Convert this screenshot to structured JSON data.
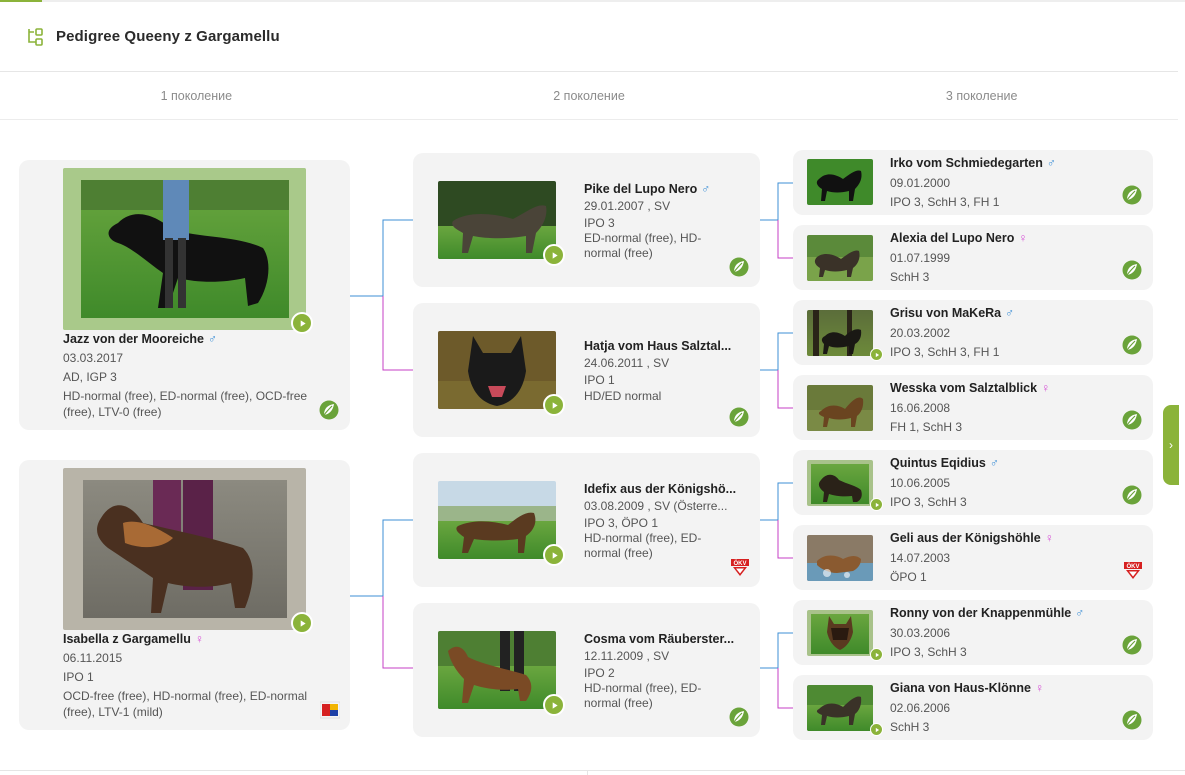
{
  "header": {
    "title": "Pedigree Queeny z Gargamellu",
    "icon": "pedigree-tree-icon"
  },
  "generations": [
    "1 поколение",
    "2 поколение",
    "3 поколение"
  ],
  "colors": {
    "accent": "#8bb33a",
    "male_link": "#3d8fd6",
    "female_link": "#c63fc6"
  },
  "gen1": [
    {
      "name": "Jazz von der Mooreiche",
      "sex": "♂",
      "sexclass": "male",
      "date": "03.03.2017",
      "titles": "AD, IGP 3",
      "health": "HD-normal (free), ED-normal (free), OCD-free (free), LTV-0 (free)",
      "badge": "leaf-icon"
    },
    {
      "name": "Isabella z Gargamellu",
      "sex": "♀",
      "sexclass": "female",
      "date": "06.11.2015",
      "titles": "IPO 1",
      "health": "OCD-free (free), HD-normal (free), ED-normal (free), LTV-1 (mild)",
      "badge": "flag-badge-icon"
    }
  ],
  "gen2": [
    {
      "name": "Pike del Lupo Nero",
      "sex": "♂",
      "sexclass": "male",
      "date": "29.01.2007 , SV",
      "titles": "IPO 3",
      "health": "ED-normal (free), HD-normal (free)",
      "badge": "leaf-icon"
    },
    {
      "name": "Hatja vom Haus Salztal...",
      "sex": "",
      "sexclass": "female",
      "date": "24.06.2011 , SV",
      "titles": "IPO 1",
      "health": "HD/ED normal",
      "badge": "leaf-icon"
    },
    {
      "name": "Idefix aus der Königshö...",
      "sex": "",
      "sexclass": "male",
      "date": "03.08.2009 , SV (Österre...",
      "titles": "IPO 3, ÖPO 1",
      "health": "HD-normal (free), ED-normal (free)",
      "badge": "okv-badge-icon"
    },
    {
      "name": "Cosma vom Räuberster...",
      "sex": "",
      "sexclass": "female",
      "date": "12.11.2009 , SV",
      "titles": "IPO 2",
      "health": "HD-normal (free), ED-normal (free)",
      "badge": "leaf-icon"
    }
  ],
  "gen3": [
    {
      "name": "Irko vom Schmiedegarten",
      "sex": "♂",
      "sexclass": "male",
      "date": "09.01.2000",
      "titles": "IPO 3, SchH 3, FH 1",
      "badge": "leaf-icon"
    },
    {
      "name": "Alexia del Lupo Nero",
      "sex": "♀",
      "sexclass": "female",
      "date": "01.07.1999",
      "titles": "SchH 3",
      "badge": "leaf-icon"
    },
    {
      "name": "Grisu von MaKeRa",
      "sex": "♂",
      "sexclass": "male",
      "date": "20.03.2002",
      "titles": "IPO 3, SchH 3, FH 1",
      "badge": "leaf-icon"
    },
    {
      "name": "Wesska vom Salztalblick",
      "sex": "♀",
      "sexclass": "female",
      "date": "16.06.2008",
      "titles": "FH 1, SchH 3",
      "badge": "leaf-icon"
    },
    {
      "name": "Quintus Eqidius",
      "sex": "♂",
      "sexclass": "male",
      "date": "10.06.2005",
      "titles": "IPO 3, SchH 3",
      "badge": "leaf-icon"
    },
    {
      "name": "Geli aus der Königshöhle",
      "sex": "♀",
      "sexclass": "female",
      "date": "14.07.2003",
      "titles": "ÖPO 1",
      "badge": "okv-badge-icon"
    },
    {
      "name": "Ronny von der Knappenmühle",
      "sex": "♂",
      "sexclass": "male",
      "date": "30.03.2006",
      "titles": "IPO 3, SchH 3",
      "badge": "leaf-icon"
    },
    {
      "name": "Giana von Haus-Klönne",
      "sex": "♀",
      "sexclass": "female",
      "date": "02.06.2006",
      "titles": "SchH 3",
      "badge": "leaf-icon"
    }
  ],
  "sidetab": {
    "label": "›"
  }
}
